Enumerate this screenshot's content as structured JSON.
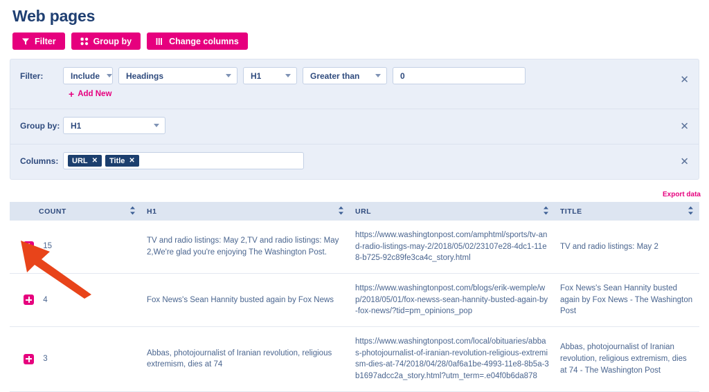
{
  "page": {
    "title": "Web pages"
  },
  "toolbar": {
    "buttons": [
      {
        "label": "Filter",
        "icon": "funnel-icon"
      },
      {
        "label": "Group by",
        "icon": "grid-dots-icon"
      },
      {
        "label": "Change columns",
        "icon": "columns-icon"
      }
    ]
  },
  "query_panel": {
    "filter": {
      "label": "Filter:",
      "include_value": "Include",
      "field_value": "Headings",
      "subfield_value": "H1",
      "operator_value": "Greater than",
      "number_value": "0",
      "number_placeholder": "0",
      "add_new_label": "Add New",
      "add_new_plus": "+",
      "close_glyph": "✕"
    },
    "group_by": {
      "label": "Group by:",
      "value": "H1",
      "close_glyph": "✕"
    },
    "columns": {
      "label": "Columns:",
      "tokens": [
        "URL",
        "Title"
      ],
      "token_remove_glyph": "✕",
      "close_glyph": "✕"
    }
  },
  "export": {
    "label": "Export data"
  },
  "table": {
    "headers": [
      "COUNT",
      "H1",
      "URL",
      "TITLE"
    ],
    "rows": [
      {
        "count": "15",
        "h1": "TV and radio listings: May 2,TV and radio listings: May 2,We're glad you're enjoying The Washington Post.",
        "url": "https://www.washingtonpost.com/amphtml/sports/tv-and-radio-listings-may-2/2018/05/02/23107e28-4dc1-11e8-b725-92c89fe3ca4c_story.html",
        "title": "TV and radio listings: May 2"
      },
      {
        "count": "4",
        "h1": "Fox News's Sean Hannity busted again by Fox News",
        "url": "https://www.washingtonpost.com/blogs/erik-wemple/wp/2018/05/01/fox-newss-sean-hannity-busted-again-by-fox-news/?tid=pm_opinions_pop",
        "title": "Fox News's Sean Hannity busted again by Fox News - The Washington Post"
      },
      {
        "count": "3",
        "h1": "Abbas, photojournalist of Iranian revolution, religious extremism, dies at 74",
        "url": "https://www.washingtonpost.com/local/obituaries/abbas-photojournalist-of-iranian-revolution-religious-extremism-dies-at-74/2018/04/28/0af6a1be-4993-11e8-8b5a-3b1697adcc2a_story.html?utm_term=.e04f0b6da878",
        "title": "Abbas, photojournalist of Iranian revolution, religious extremism, dies at 74 - The Washington Post"
      }
    ]
  },
  "annotation": {
    "type": "arrow",
    "color": "#e8441a",
    "points_to": "row-1-expander"
  },
  "colors": {
    "accent_pink": "#e6007e",
    "link_pink": "#f2569c",
    "text_blue": "#2e4a7d",
    "panel_bg": "#eaeff8",
    "table_header_bg": "#dde5f1",
    "token_bg": "#1c3f6e",
    "annotation_red": "#e8441a"
  }
}
